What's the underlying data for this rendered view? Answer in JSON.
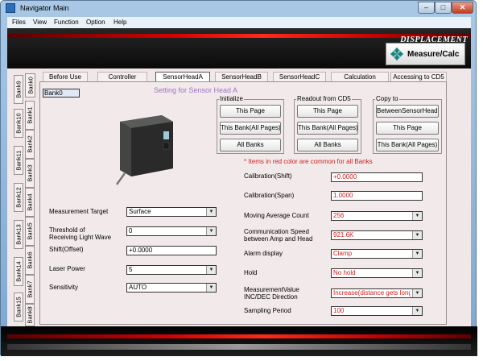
{
  "window": {
    "title": "Navigator Main",
    "min_glyph": "–",
    "max_glyph": "□",
    "close_glyph": "✕"
  },
  "menu": [
    "Files",
    "View",
    "Function",
    "Option",
    "Help"
  ],
  "banner": {
    "title": "DISPLACEMENT",
    "button_label": "Measure/Calc"
  },
  "banks_left": [
    "Bank9",
    "Bank10",
    "Bank11",
    "Bank12",
    "Bank13",
    "Bank14",
    "Bank15"
  ],
  "banks_right": [
    "Bank0",
    "Bank1",
    "Bank2",
    "Bank3",
    "Bank4",
    "Bank5",
    "Bank6",
    "Bank7",
    "Bank8"
  ],
  "tabs": [
    "Before Use",
    "Controller",
    "SensorHeadA",
    "SensorHeadB",
    "SensorHeadC",
    "Calculation",
    "Accessing to CD5"
  ],
  "active_tab": "SensorHeadA",
  "bank_label": "Bank0",
  "setting_title": "Setting for Sensor Head A",
  "initialize": {
    "label": "Initialize",
    "buttons": [
      "This Page",
      "This Bank(All Pages)",
      "All Banks"
    ]
  },
  "readout": {
    "label": "Readout from CD5",
    "buttons": [
      "This Page",
      "This Bank(All Pages)",
      "All Banks"
    ]
  },
  "copyto": {
    "label": "Copy to",
    "buttons": [
      "BetweenSensorHeads",
      "This Page",
      "This Bank(All Pages)"
    ]
  },
  "note": "* Items in red color are common for all Banks",
  "left_fields": {
    "measurement_target": {
      "label": "Measurement Target",
      "value": "Surface"
    },
    "threshold": {
      "label1": "Threshold of",
      "label2": "Receiving Light Wave",
      "value": "0"
    },
    "shift_offset": {
      "label": "Shift(Offset)",
      "value": "+0.0000"
    },
    "laser_power": {
      "label": "Laser Power",
      "value": "5"
    },
    "sensitivity": {
      "label": "Sensitivity",
      "value": "AUTO"
    }
  },
  "right_fields": {
    "calibration_shift": {
      "label": "Calibration(Shift)",
      "value": "+0.0000"
    },
    "calibration_span": {
      "label": "Calibration(Span)",
      "value": "1.0000"
    },
    "moving_average": {
      "label": "Moving Average Count",
      "value": "256"
    },
    "comm_speed": {
      "label1": "Communication Speed",
      "label2": "between Amp and Head",
      "value": "921.6K"
    },
    "alarm_display": {
      "label": "Alarm display",
      "value": "Clamp"
    },
    "hold": {
      "label": "Hold",
      "value": "No hold"
    },
    "mv_direction": {
      "label1": "MeasurementValue",
      "label2": "INC/DEC Direction",
      "value": "Increase(distance gets long"
    },
    "sampling_period": {
      "label": "Sampling Period",
      "value": "100"
    }
  },
  "colors": {
    "accent_red": "#d21d1d",
    "title_purple": "#a070c8",
    "panel_bg": "#f2eaea",
    "banner_bg": "#111111"
  }
}
